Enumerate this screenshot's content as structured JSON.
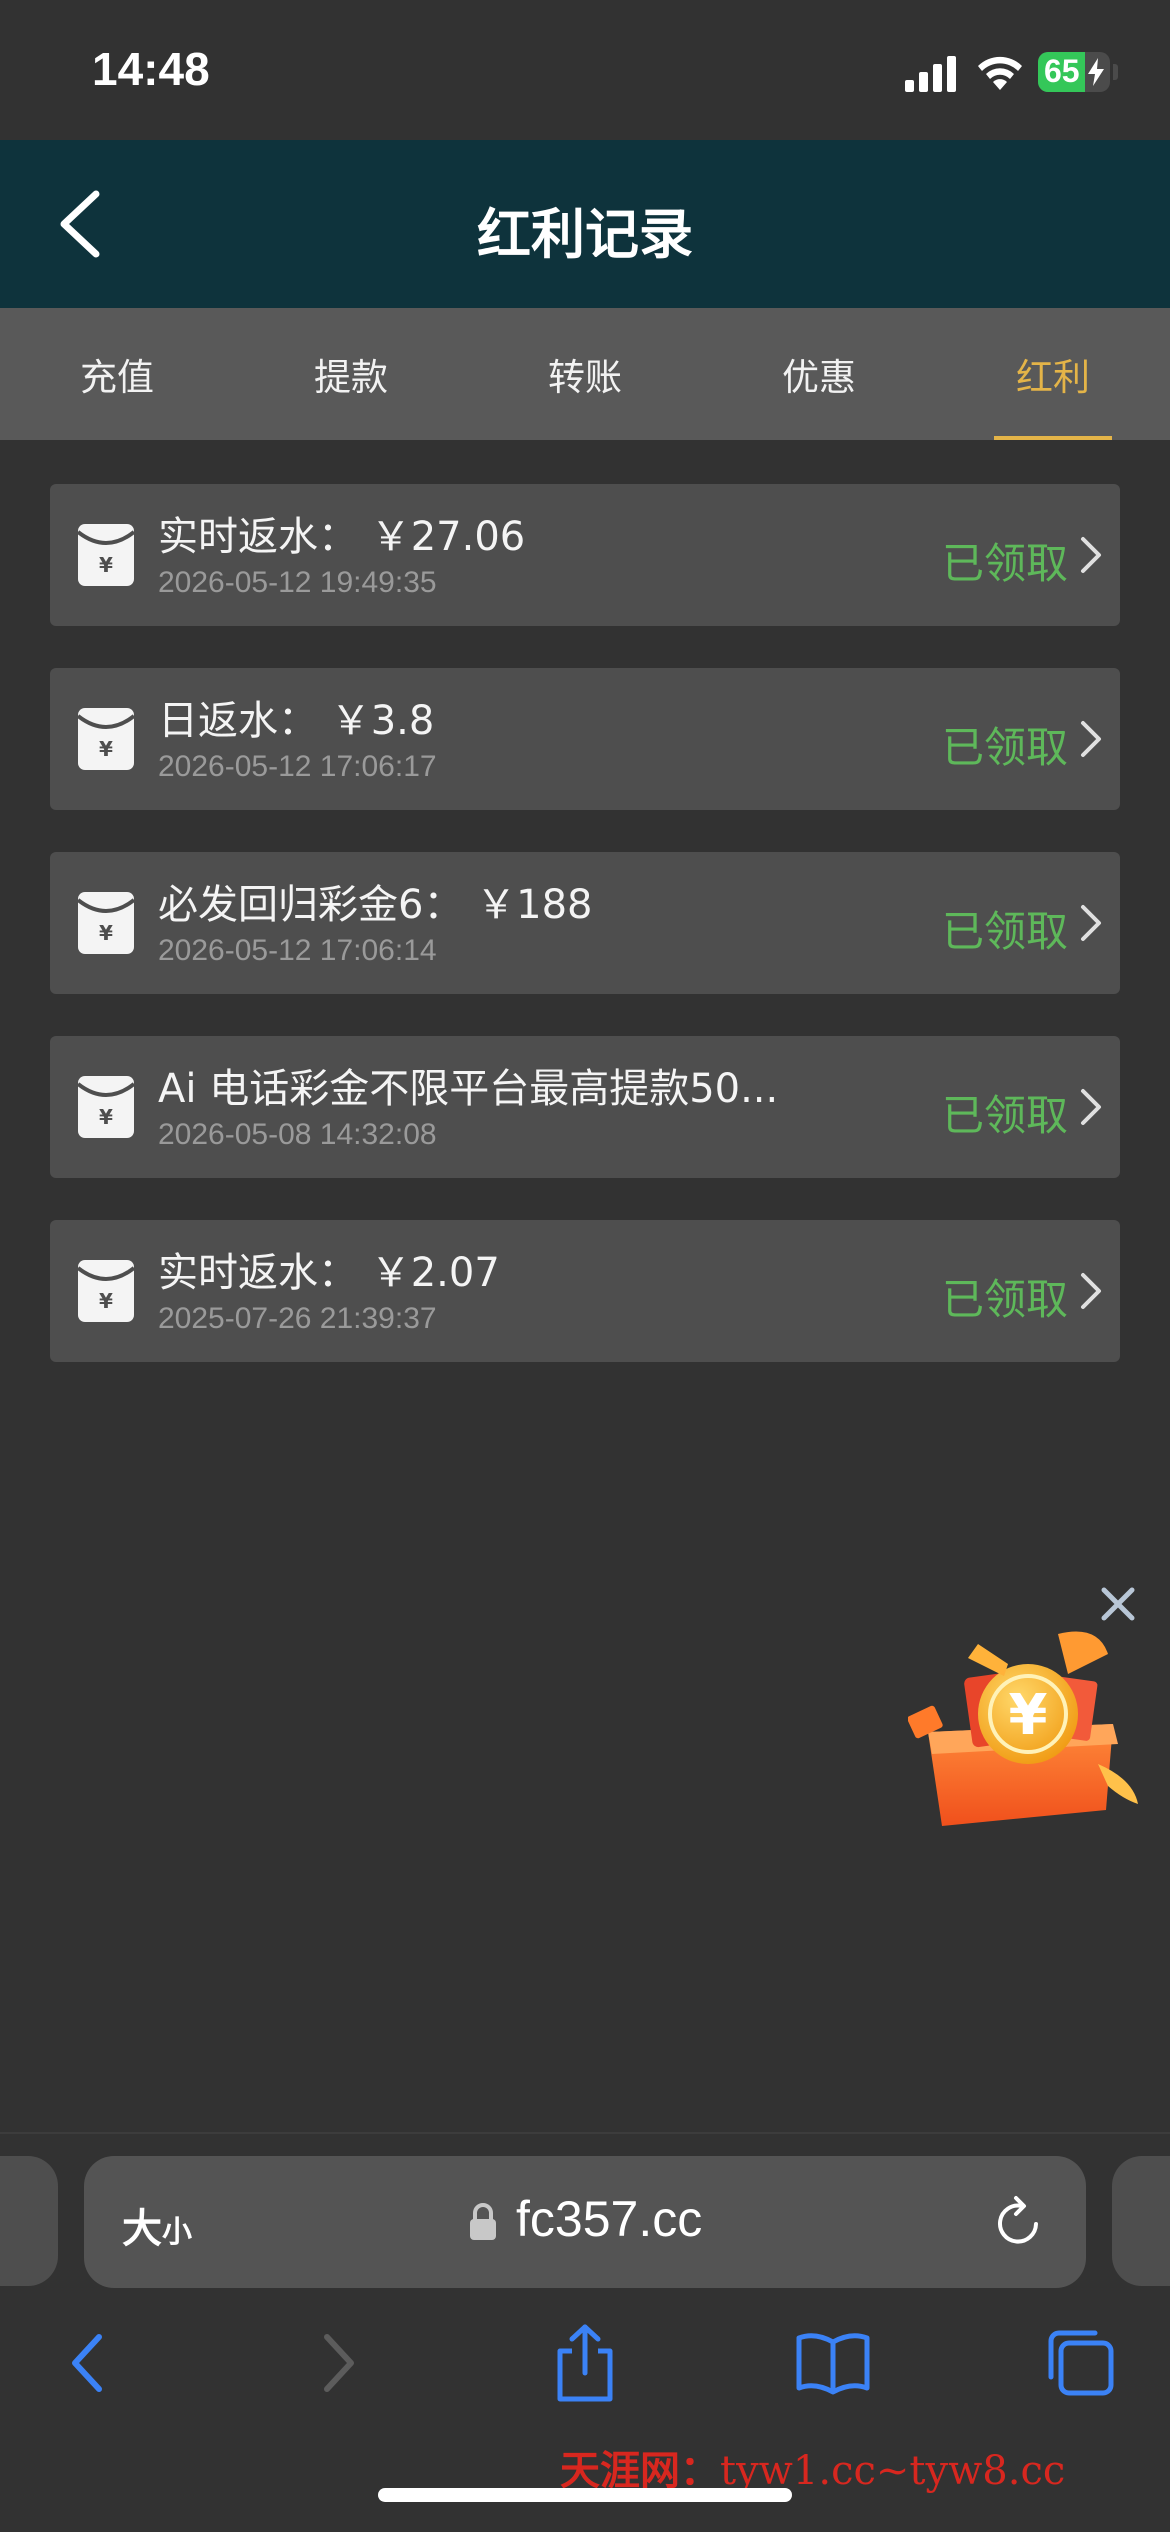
{
  "status_bar": {
    "time": "14:48",
    "battery_percent": 65,
    "battery_text": "65",
    "icons": [
      "signal-icon",
      "wifi-icon",
      "battery-charging-icon"
    ]
  },
  "header": {
    "title": "红利记录",
    "back_icon": "chevron-left-icon"
  },
  "tabs": [
    {
      "label": "充值",
      "active": false
    },
    {
      "label": "提款",
      "active": false
    },
    {
      "label": "转账",
      "active": false
    },
    {
      "label": "优惠",
      "active": false
    },
    {
      "label": "红利",
      "active": true
    }
  ],
  "records": [
    {
      "title": "实时返水： ￥27.06",
      "time": "2026-05-12 19:49:35",
      "status": "已领取"
    },
    {
      "title": "日返水： ￥3.8",
      "time": "2026-05-12 17:06:17",
      "status": "已领取"
    },
    {
      "title": "必发回归彩金6： ￥188",
      "time": "2026-05-12 17:06:14",
      "status": "已领取"
    },
    {
      "title": "Ai 电话彩金不限平台最高提款50...",
      "time": "2026-05-08 14:32:08",
      "status": "已领取"
    },
    {
      "title": "实时返水： ￥2.07",
      "time": "2025-07-26 21:39:37",
      "status": "已领取"
    }
  ],
  "browser": {
    "text_size_big": "大",
    "text_size_small": "小",
    "url": "fc357.cc",
    "toolbar_icons": [
      "back-icon",
      "forward-icon",
      "share-icon",
      "bookmarks-icon",
      "tabs-icon"
    ]
  },
  "watermark": {
    "cn": "天涯网：",
    "url": "tyw1.cc~tyw8.cc"
  },
  "colors": {
    "background": "#323232",
    "header": "#0e333c",
    "tab_bar": "#595959",
    "active_tab": "#e4b448",
    "card": "#4e4e4e",
    "status_green": "#5eb85a",
    "browser_blue": "#3b82f6",
    "watermark_red": "#d8271f"
  }
}
